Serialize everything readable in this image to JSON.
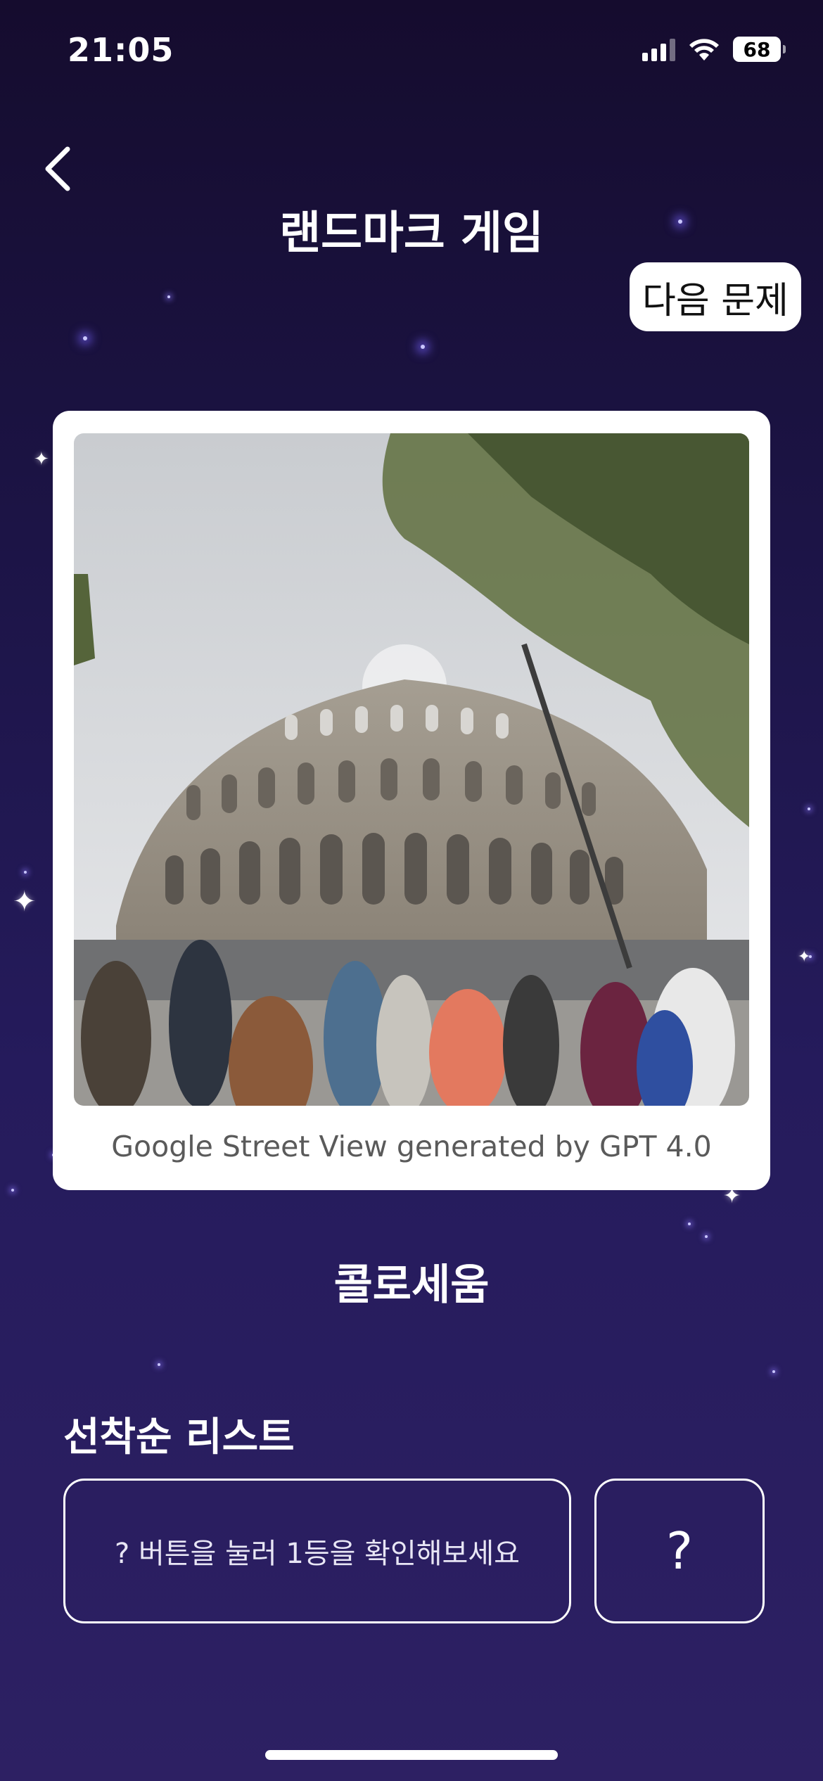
{
  "status_bar": {
    "time": "21:05",
    "battery": "68",
    "icons": [
      "cellular-signal-icon",
      "wifi-icon",
      "battery-icon"
    ]
  },
  "header": {
    "back_icon": "chevron-left-icon",
    "title": "랜드마크 게임",
    "next_button_label": "다음 문제"
  },
  "card": {
    "image_subject": "Colosseum street view photo",
    "caption": "Google Street View generated by GPT 4.0"
  },
  "answer": "콜로세움",
  "leaderboard": {
    "title": "선착순 리스트",
    "hint": "? 버튼을 눌러 1등을 확인해보세요",
    "reveal_button_label": "?"
  },
  "colors": {
    "background_top": "#150c2e",
    "background_bottom": "#2d2063",
    "card": "#ffffff",
    "caption": "#5a5a5a"
  }
}
